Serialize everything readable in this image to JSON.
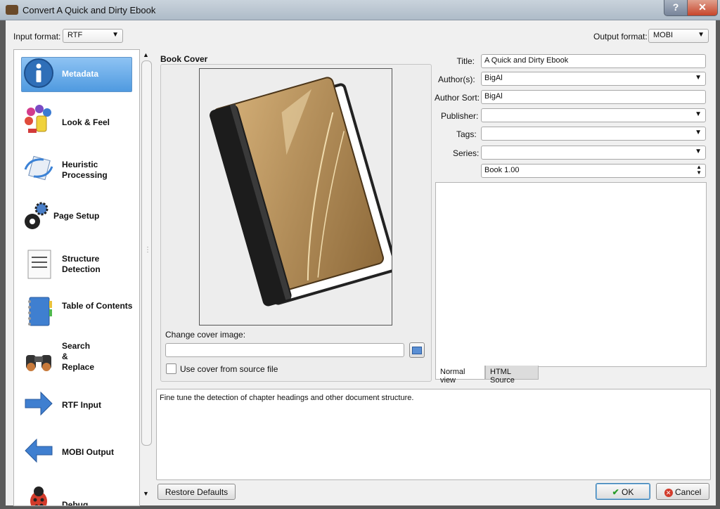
{
  "window": {
    "title": "Convert A Quick and Dirty Ebook",
    "help_label": "?",
    "close_label": "✕"
  },
  "input_format": {
    "label": "Input format:",
    "value": "RTF"
  },
  "output_format": {
    "label": "Output format:",
    "value": "MOBI"
  },
  "sidebar": {
    "items": [
      {
        "label": "Metadata",
        "icon": "info-icon",
        "selected": true
      },
      {
        "label": "Look & Feel",
        "icon": "palette-icon"
      },
      {
        "label": "Heuristic Processing",
        "icon": "heuristic-icon"
      },
      {
        "label": "Page Setup",
        "icon": "gears-icon"
      },
      {
        "label": "Structure Detection",
        "icon": "document-icon"
      },
      {
        "label": "Table of Contents",
        "icon": "notebook-icon"
      },
      {
        "label": "Search & Replace",
        "icon": "binoculars-icon"
      },
      {
        "label": "RTF Input",
        "icon": "arrow-right-icon"
      },
      {
        "label": "MOBI Output",
        "icon": "arrow-left-icon"
      },
      {
        "label": "Debug",
        "icon": "bug-icon"
      }
    ]
  },
  "cover": {
    "heading": "Book Cover",
    "change_label": "Change cover image:",
    "path_value": "",
    "use_source_label": "Use cover from source file",
    "use_source_checked": false
  },
  "metadata": {
    "title_label": "Title:",
    "title_value": "A Quick and Dirty Ebook",
    "authors_label": "Author(s):",
    "authors_value": "BigAl",
    "author_sort_label": "Author Sort:",
    "author_sort_value": "BigAl",
    "publisher_label": "Publisher:",
    "publisher_value": "",
    "tags_label": "Tags:",
    "tags_value": "",
    "series_label": "Series:",
    "series_value": "",
    "series_index": "Book 1.00"
  },
  "tabs": {
    "normal": "Normal view",
    "html": "HTML Source"
  },
  "description": "Fine tune the detection of chapter headings and other document structure.",
  "buttons": {
    "restore": "Restore Defaults",
    "ok": "OK",
    "cancel": "Cancel"
  },
  "colors": {
    "accent": "#4f9ae0",
    "book": "#b08850"
  }
}
